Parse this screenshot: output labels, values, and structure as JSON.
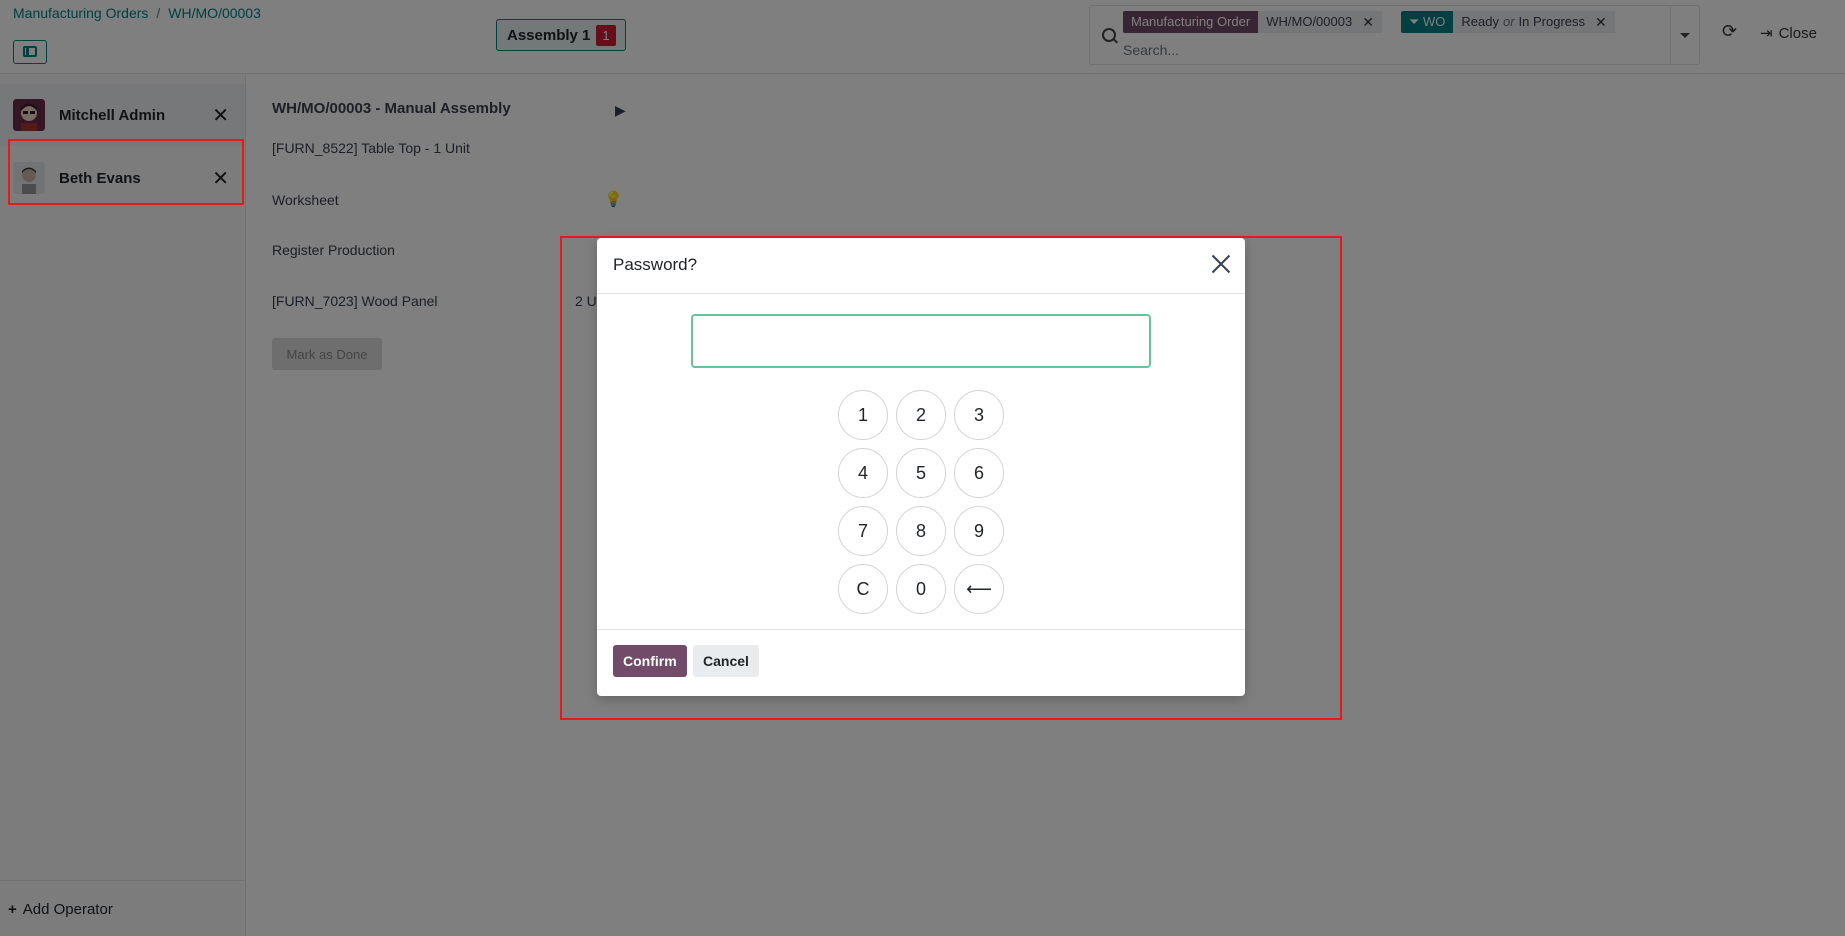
{
  "breadcrumb": {
    "root": "Manufacturing Orders",
    "separator": "/",
    "current": "WH/MO/00003"
  },
  "workcenter": {
    "label": "Assembly 1",
    "badge": "1"
  },
  "search": {
    "facet1_label": "Manufacturing Order",
    "facet1_value": "WH/MO/00003",
    "facet2_label": "WO",
    "facet2_value_a": "Ready",
    "facet2_or": "or",
    "facet2_value_b": "In Progress",
    "placeholder": "Search..."
  },
  "header_actions": {
    "close_label": "Close"
  },
  "operators": [
    {
      "name": "Mitchell Admin"
    },
    {
      "name": "Beth Evans"
    }
  ],
  "add_operator_label": "Add Operator",
  "workorder": {
    "title": "WH/MO/00003 - Manual Assembly",
    "product": "[FURN_8522] Table Top - 1 Unit",
    "worksheet": "Worksheet",
    "register": "Register Production",
    "component": "[FURN_7023] Wood Panel",
    "component_qty": "2 U",
    "mark_done": "Mark as Done"
  },
  "dialog": {
    "title": "Password?",
    "keys": [
      "1",
      "2",
      "3",
      "4",
      "5",
      "6",
      "7",
      "8",
      "9",
      "C",
      "0",
      "⟵"
    ],
    "confirm": "Confirm",
    "cancel": "Cancel"
  },
  "colors": {
    "accent": "#017e84",
    "primary": "#714b67",
    "badge": "#c81f32",
    "highlight": "#e51b1b"
  }
}
